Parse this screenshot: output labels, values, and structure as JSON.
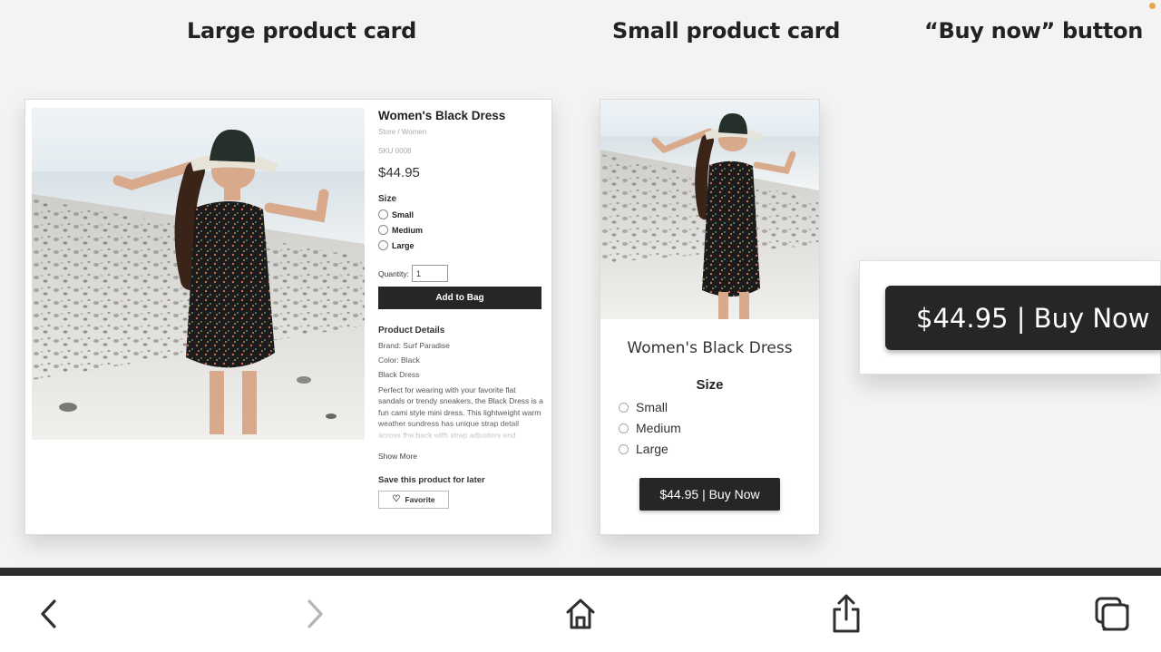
{
  "headings": {
    "large": "Large product card",
    "small": "Small product card",
    "buy": "“Buy now” button"
  },
  "large_card": {
    "title": "Women's Black Dress",
    "breadcrumb": "Store  /  Women",
    "sku": "SKU 0008",
    "price": "$44.95",
    "size_label": "Size",
    "sizes": [
      "Small",
      "Medium",
      "Large"
    ],
    "quantity_label": "Quantity:",
    "quantity_value": "1",
    "add_to_bag": "Add to Bag",
    "product_details_title": "Product Details",
    "brand": "Brand: Surf Paradise",
    "color": "Color: Black",
    "name_line": "Black Dress",
    "description": "Perfect for wearing with your favorite flat sandals or trendy sneakers, the Black Dress is a fun cami style mini dress. This lightweight warm weather sundress has unique strap detail across the back with strap adjusters and features self binding",
    "show_more": "Show More",
    "save_label": "Save this product for later",
    "favorite": "Favorite"
  },
  "small_card": {
    "title": "Women's Black Dress",
    "size_label": "Size",
    "sizes": [
      "Small",
      "Medium",
      "Large"
    ],
    "buy_button": "$44.95 | Buy Now"
  },
  "buy_panel": {
    "button": "$44.95 | Buy Now"
  },
  "toolbar": {
    "icons": [
      "back-icon",
      "forward-icon",
      "home-icon",
      "share-icon",
      "tabs-icon"
    ]
  },
  "colors": {
    "background": "#f3f3f3",
    "button_dark": "#262626",
    "indicator_orange": "#f0a44a"
  }
}
